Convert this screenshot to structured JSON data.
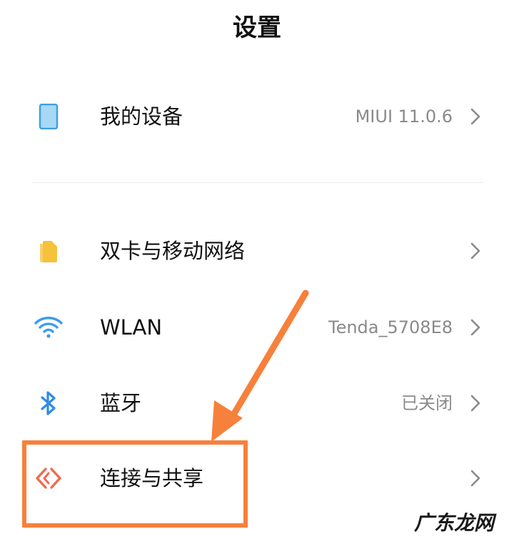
{
  "header": {
    "title": "设置"
  },
  "rows": [
    {
      "label": "我的设备",
      "value": "MIUI 11.0.6",
      "icon": "device-icon"
    },
    {
      "label": "双卡与移动网络",
      "value": "",
      "icon": "sim-card-icon"
    },
    {
      "label": "WLAN",
      "value": "Tenda_5708E8",
      "icon": "wifi-icon"
    },
    {
      "label": "蓝牙",
      "value": "已关闭",
      "icon": "bluetooth-icon"
    },
    {
      "label": "连接与共享",
      "value": "",
      "icon": "connection-share-icon"
    }
  ],
  "colors": {
    "device": "#a8d8f5",
    "device_border": "#3f9fe0",
    "sim": "#f6c23a",
    "wifi": "#3b9cf0",
    "bluetooth": "#2f8be8",
    "share": "#f06a4f",
    "annotation": "#f7803a"
  },
  "watermark": "广东龙网"
}
